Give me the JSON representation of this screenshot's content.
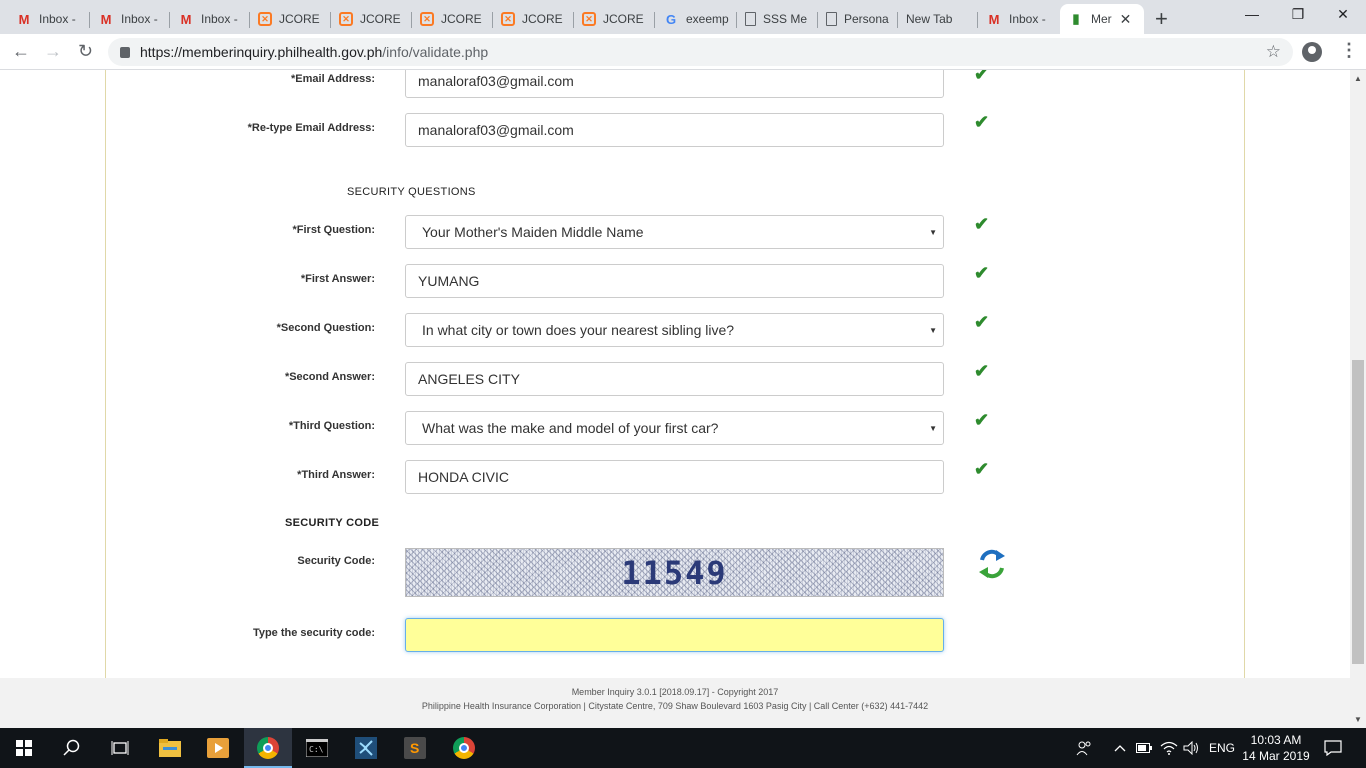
{
  "browser": {
    "tabs": [
      {
        "title": "Inbox -",
        "icon": "gmail-icon"
      },
      {
        "title": "Inbox -",
        "icon": "gmail-icon"
      },
      {
        "title": "Inbox -",
        "icon": "gmail-icon"
      },
      {
        "title": "JCORE -",
        "icon": "xampp-icon"
      },
      {
        "title": "JCORE -",
        "icon": "xampp-icon"
      },
      {
        "title": "JCORE -",
        "icon": "xampp-icon"
      },
      {
        "title": "JCORE -",
        "icon": "xampp-icon"
      },
      {
        "title": "JCORE -",
        "icon": "xampp-icon"
      },
      {
        "title": "exeemp",
        "icon": "google-icon"
      },
      {
        "title": "SSS Me",
        "icon": "document-icon"
      },
      {
        "title": "Persona",
        "icon": "document-icon"
      },
      {
        "title": "New Tab",
        "icon": ""
      },
      {
        "title": "Inbox -",
        "icon": "gmail-icon"
      },
      {
        "title": "Mer",
        "icon": "philhealth-icon",
        "active": true
      }
    ],
    "url_host": "https://memberinquiry.philhealth.gov.ph",
    "url_path": "/info/validate.php"
  },
  "form": {
    "email_label": "*Email Address:",
    "email_value": "manaloraf03@gmail.com",
    "retype_email_label": "*Re-type Email Address:",
    "retype_email_value": "manaloraf03@gmail.com",
    "security_questions_heading": "SECURITY QUESTIONS",
    "first_question_label": "*First Question:",
    "first_question_value": "Your Mother's Maiden Middle Name",
    "first_answer_label": "*First Answer:",
    "first_answer_value": "YUMANG",
    "second_question_label": "*Second Question:",
    "second_question_value": "In what city or town does your nearest sibling live?",
    "second_answer_label": "*Second Answer:",
    "second_answer_value": "ANGELES CITY",
    "third_question_label": "*Third Question:",
    "third_question_value": "What was the make and model of your first car?",
    "third_answer_label": "*Third Answer:",
    "third_answer_value": "HONDA CIVIC",
    "security_code_heading": "SECURITY CODE",
    "security_code_label": "Security Code:",
    "security_code_value": "11549",
    "type_code_label": "Type the security code:",
    "type_code_value": ""
  },
  "footer": {
    "line1": "Member Inquiry 3.0.1 [2018.09.17] - Copyright 2017",
    "line2": "Philippine Health Insurance Corporation | Citystate Centre, 709 Shaw Boulevard 1603 Pasig City | Call Center (+632) 441-7442"
  },
  "taskbar": {
    "language": "ENG",
    "time": "10:03 AM",
    "date": "14 Mar 2019"
  },
  "colors": {
    "check_green": "#2e8b2e",
    "captcha_text": "#2b3a78",
    "input_highlight": "#ffff99"
  }
}
